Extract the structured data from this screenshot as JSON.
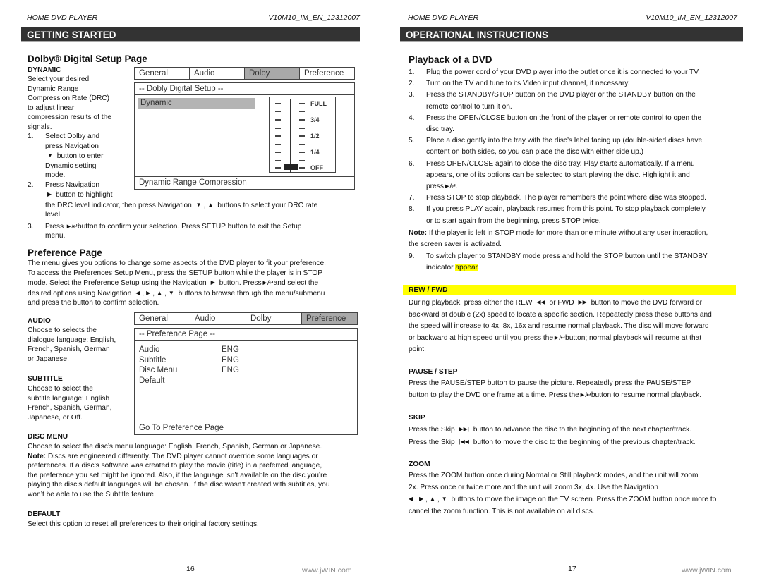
{
  "header": {
    "product": "HOME DVD PLAYER",
    "doc_code": "V10M10_IM_EN_12312007"
  },
  "left_page": {
    "section_title": "GETTING STARTED",
    "dolby": {
      "heading": "Dolby® Digital Setup Page",
      "sub": "DYNAMIC",
      "intro_lines": [
        "Select your desired",
        "Dynamic Range",
        "Compression Rate (DRC)",
        "to adjust linear",
        "compression results of the",
        "signals."
      ],
      "step1": {
        "num": "1.",
        "lines": [
          "Select Dolby and",
          "press Navigation",
          "button to enter",
          "Dynamic setting",
          "mode."
        ]
      },
      "step2": {
        "num": "2.",
        "line1": "Press Navigation",
        "line2": "button to highlight",
        "line3a": "the DRC level indicator, then press Navigation",
        "line3b": "buttons to select your DRC rate",
        "line4": "level."
      },
      "step3": {
        "num": "3.",
        "a": "Press",
        "b": "button to confirm your selection. Press SETUP button to exit the Setup",
        "c": "menu."
      }
    },
    "osd_dolby": {
      "tabs": [
        "General",
        "Audio",
        "Dolby",
        "Preference"
      ],
      "active_tab": "Dolby",
      "title": "-- Dobly  Digital  Setup --",
      "item": "Dynamic",
      "levels": [
        "FULL",
        "3/4",
        "1/2",
        "1/4",
        "OFF"
      ],
      "current_level": "OFF",
      "footer": "Dynamic Range Compression"
    },
    "preference": {
      "heading": "Preference Page",
      "l1": "The menu gives you options to change some aspects of the DVD player to fit your preference.",
      "l2": "To access the Preferences Setup Menu, press the SETUP button while the player is in STOP",
      "l3a": "mode. Select the Preference Setup using the Navigation",
      "l3b": "button. Press",
      "l3c": "and select the",
      "l4a": "desired options using Navigation",
      "l4b": "buttons to browse through the menu/submenu",
      "l5": "and press the button to confirm selection.",
      "audio": {
        "title": "AUDIO",
        "lines": [
          "Choose to selects the",
          "dialogue language: English,",
          "French, Spanish, German",
          "or Japanese."
        ]
      },
      "subtitle": {
        "title": "SUBTITLE",
        "lines": [
          "Choose to select the",
          "subtitle language: English",
          "French, Spanish, German,",
          "Japanese, or Off."
        ]
      },
      "disc_menu": {
        "title": "DISC MENU",
        "l1": "Choose to select the disc’s menu language: English, French, Spanish, German or Japanese.",
        "note_label": "Note:",
        "l2": " Discs are engineered differently. The DVD player cannot override some languages or",
        "l3": "preferences. If a disc’s software was created to play the movie (title) in a preferred language,",
        "l4": "the preference you set might be ignored. Also, if the language isn’t available on the disc you’re",
        "l5": "playing the disc’s default languages will be chosen. If the disc wasn’t created with subtitles, you",
        "l6": "won’t be able to use the Subtitle feature."
      },
      "default": {
        "title": "DEFAULT",
        "text": "Select this option to reset all preferences to their original factory settings."
      }
    },
    "osd_pref": {
      "tabs": [
        "General",
        "Audio",
        "Dolby",
        "Preference"
      ],
      "active_tab": "Preference",
      "title": "-- Preference  Page --",
      "rows": [
        {
          "label": "Audio",
          "value": "ENG"
        },
        {
          "label": "Subtitle",
          "value": "ENG"
        },
        {
          "label": "Disc Menu",
          "value": "ENG"
        },
        {
          "label": "Default",
          "value": ""
        }
      ],
      "footer": "Go To Preference Page"
    },
    "page_number": "16",
    "url": "www.jWIN.com"
  },
  "right_page": {
    "section_title": "OPERATIONAL INSTRUCTIONS",
    "playback": {
      "heading": "Playback of a DVD",
      "steps": [
        {
          "num": "1.",
          "lines": [
            "Plug the power cord of your DVD player into the outlet once it is connected to your TV."
          ]
        },
        {
          "num": "2.",
          "lines": [
            "Turn on the TV and tune to its Video input channel, if necessary."
          ]
        },
        {
          "num": "3.",
          "lines": [
            "Press the STANDBY/STOP button on the DVD player or the STANDBY button on the",
            "remote control to turn it on."
          ]
        },
        {
          "num": "4.",
          "lines": [
            "Press the OPEN/CLOSE button on the front of the player or remote control to open the",
            "disc tray."
          ]
        },
        {
          "num": "5.",
          "lines": [
            "Place a disc gently into the tray with the disc’s label facing up (double-sided discs have",
            "content on both sides, so you can place the disc with either side up.)"
          ]
        },
        {
          "num": "6.",
          "lines": [
            "Press OPEN/CLOSE again to close the disc tray. Play starts automatically. If a menu",
            "appears, one of its options can be selected to start playing the disc. Highlight it and"
          ],
          "last": "press"
        },
        {
          "num": "7.",
          "lines": [
            "Press STOP to stop playback. The player remembers the point where disc was stopped."
          ]
        },
        {
          "num": "8.",
          "lines": [
            "If you press PLAY again, playback resumes from this point. To stop playback completely",
            "or to start again from the beginning, press STOP twice."
          ]
        }
      ],
      "note_label": "Note:",
      "note_l1": " If the player is left in STOP mode for more than one minute without any user interaction,",
      "note_l2": "the screen saver is activated.",
      "step9": {
        "num": "9.",
        "l1": "To switch player to STANDBY mode press and hold the STOP button until the STANDBY",
        "l2a": "indicator ",
        "l2b": "appear",
        "l2c": "."
      }
    },
    "rew_fwd": {
      "title": "REW / FWD",
      "l1a": "During playback, press either the REW",
      "l1b": "or FWD",
      "l1c": "button to move the DVD forward or",
      "l2": "backward at double (2x) speed to locate a specific section. Repeatedly press these buttons and",
      "l3": "the speed will increase to 4x, 8x, 16x and resume normal playback. The disc will move forward",
      "l4a": "or backward at high speed until you press the",
      "l4b": "button; normal playback will resume at that",
      "l5": "point."
    },
    "pause_step": {
      "title": "PAUSE / STEP",
      "l1": "Press the PAUSE/STEP button to pause the picture. Repeatedly press the PAUSE/STEP",
      "l2a": "button to play the DVD one frame at a time. Press the",
      "l2b": "button to resume normal playback."
    },
    "skip": {
      "title": "SKIP",
      "l1a": "Press the Skip",
      "l1b": "button to advance the disc to the beginning of the next chapter/track.",
      "l2a": "Press the Skip",
      "l2b": "button to move the disc to the beginning of the previous chapter/track."
    },
    "zoom": {
      "title": "ZOOM",
      "l1": "Press the ZOOM button once during Normal or Still playback modes, and the unit will zoom",
      "l2": "2x. Press once or twice more and the unit will zoom 3x, 4x. Use the Navigation",
      "l3": "buttons to move the image on the TV screen. Press the ZOOM button once more to",
      "l4": "cancel  the zoom function. This is not available on all discs."
    },
    "page_number": "17",
    "url": "www.jWIN.com"
  },
  "icons": {
    "nav_down": "▼",
    "nav_up": "▲",
    "nav_left": "◀",
    "nav_right": "▶",
    "play_enter": "►/↵",
    "rew": "◀◀",
    "fwd": "▶▶",
    "skip_next": "▶▶|",
    "skip_prev": "|◀◀"
  }
}
